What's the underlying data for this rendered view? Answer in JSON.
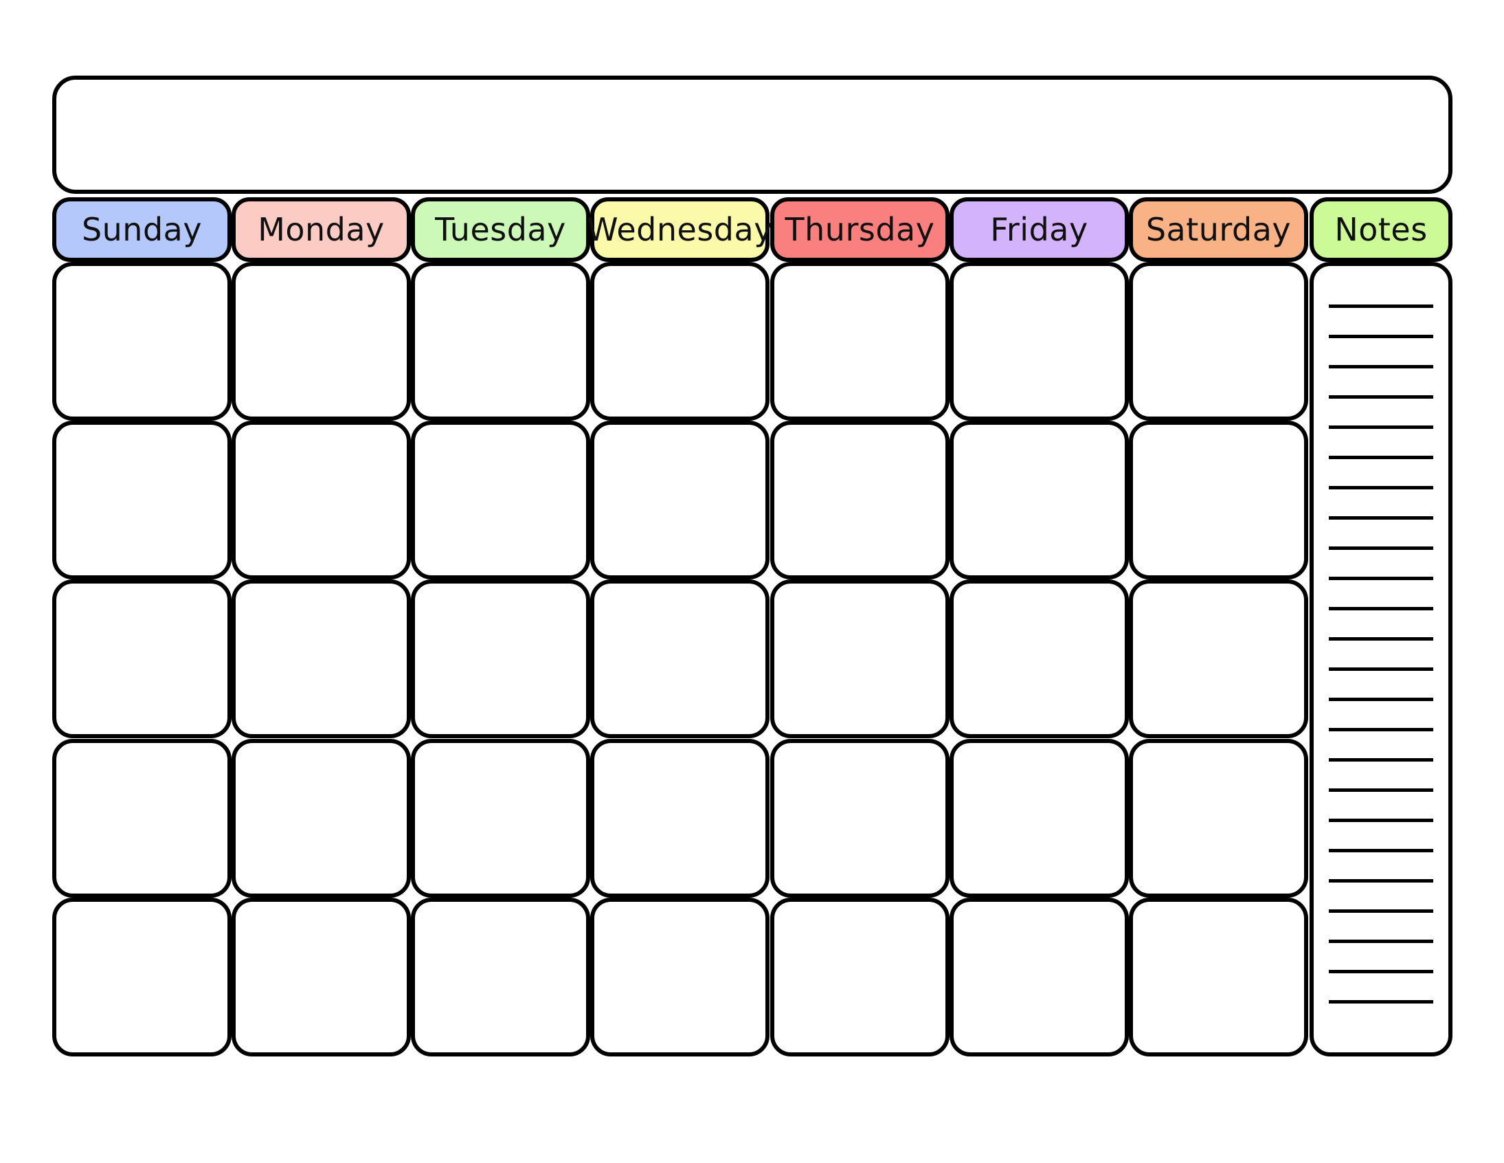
{
  "page": {
    "kind": "blank-monthly-calendar-template",
    "background_color": "#ffffff",
    "outline_color": "#000000"
  },
  "title_banner": {
    "label": "",
    "placeholder": "",
    "editable": true
  },
  "header": {
    "columns": [
      {
        "label": "Sunday",
        "color": "#b4c8fc",
        "name": "sunday"
      },
      {
        "label": "Monday",
        "color": "#fccbc4",
        "name": "monday"
      },
      {
        "label": "Tuesday",
        "color": "#ccf8b8",
        "name": "tuesday"
      },
      {
        "label": "Wednesday",
        "color": "#fafaaa",
        "name": "wednesday"
      },
      {
        "label": "Thursday",
        "color": "#f9807e",
        "name": "thursday"
      },
      {
        "label": "Friday",
        "color": "#d3b4fc",
        "name": "friday"
      },
      {
        "label": "Saturday",
        "color": "#f9b286",
        "name": "saturday"
      },
      {
        "label": "Notes",
        "color": "#ccfa96",
        "name": "notes"
      }
    ]
  },
  "grid": {
    "rows": 5,
    "columns": 7,
    "cell_background": "#ffffff",
    "cells": [
      [
        "",
        "",
        "",
        "",
        "",
        "",
        ""
      ],
      [
        "",
        "",
        "",
        "",
        "",
        "",
        ""
      ],
      [
        "",
        "",
        "",
        "",
        "",
        "",
        ""
      ],
      [
        "",
        "",
        "",
        "",
        "",
        "",
        ""
      ],
      [
        "",
        "",
        "",
        "",
        "",
        "",
        ""
      ]
    ]
  },
  "notes_panel": {
    "label": "Notes",
    "ruled_line_count": 25,
    "line_spacing_px": 44,
    "lines": [
      "",
      "",
      "",
      "",
      "",
      "",
      "",
      "",
      "",
      "",
      "",
      "",
      "",
      "",
      "",
      "",
      "",
      "",
      "",
      "",
      "",
      "",
      "",
      "",
      ""
    ]
  }
}
